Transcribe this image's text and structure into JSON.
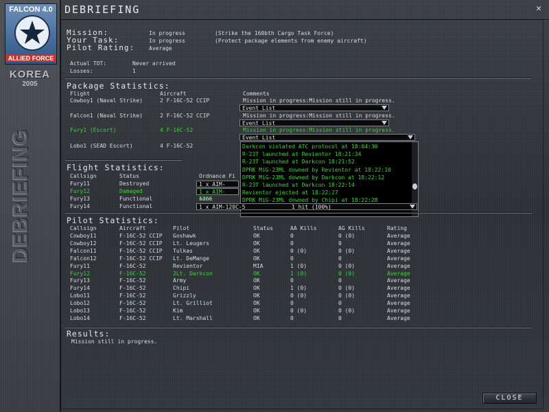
{
  "window": {
    "title": "DEBRIEFING",
    "close_icon": "close-icon"
  },
  "sidebar": {
    "logo_top": "FALCON 4.0",
    "logo_bottom": "ALLIED FORCE",
    "theater": "KOREA",
    "year": "2005",
    "vertical_title": "DEBRIEFING"
  },
  "summary": {
    "mission_label": "Mission:",
    "mission_status": "In progress",
    "mission_desc": "(Strike the 160bth Cargo Task Force)",
    "task_label": "Your Task:",
    "task_status": "In progress",
    "task_desc": "(Protect package elements from enemy aircraft)",
    "rating_label": "Pilot Rating:",
    "rating_value": "Average",
    "tot_label": "Actual TOT:",
    "tot_value": "Never arrived",
    "losses_label": "Losses:",
    "losses_value": "1"
  },
  "package": {
    "title": "Package Statistics:",
    "headers": [
      "Flight",
      "Aircraft",
      "Comments"
    ],
    "rows": [
      {
        "flight": "Cowboy1 (Naval Strike)",
        "aircraft": "2 F-16C-52 CCIP",
        "comment": "Mission in progress:Mission still in progress.",
        "dropdown": "Event List",
        "highlight": false
      },
      {
        "flight": "Falcon1 (Naval Strike)",
        "aircraft": "2 F-16C-52 CCIP",
        "comment": "Mission in progress:Mission still in progress.",
        "dropdown": "Event List",
        "highlight": false
      },
      {
        "flight": "Fury1 (Escort)",
        "aircraft": "4 F-16C-52",
        "comment": "Mission in progress:Mission still in progress.",
        "dropdown": "Event List",
        "highlight": true
      },
      {
        "flight": "Lobo1 (SEAD Escort)",
        "aircraft": "4 F-16C-52",
        "comment": "",
        "dropdown": "",
        "highlight": false
      }
    ],
    "event_list": [
      "Darkcon violated ATC protocol at 18:04:30",
      "R-23T launched at Revientor 18:21:34",
      "R-23T launched at Darkcon 18:21:52",
      "DPRK MiG-23ML downed by Revientor at 18:22:10",
      "DPRK MiG-23ML downed by Darkcon at 18:22:12",
      "R-23T launched at Darkcon 18:22:14",
      "Revientor ejected at 18:22:27",
      "DPRK MiG-23ML downed by Chipi at 18:22:28"
    ]
  },
  "flight_stats": {
    "title": "Flight Statistics:",
    "headers": [
      "Callsign",
      "Status",
      "Ordnance Fi"
    ],
    "rows": [
      {
        "callsign": "Fury11",
        "status": "Destroyed",
        "ordnance": "1 x AIM-120C",
        "hits": "",
        "highlight": false
      },
      {
        "callsign": "Fury12",
        "status": "Damaged",
        "ordnance": "1 x AIM-120C",
        "hits": "",
        "highlight": true
      },
      {
        "callsign": "Fury13",
        "status": "Functional",
        "ordnance": "none",
        "hits": "",
        "highlight": false
      },
      {
        "callsign": "Fury14",
        "status": "Functional",
        "ordnance": "1 x AIM-120C-5",
        "hits": "1 hit (100%)",
        "highlight": false
      }
    ]
  },
  "pilot_stats": {
    "title": "Pilot Statistics:",
    "headers": [
      "Callsign",
      "Aircraft",
      "Pilot",
      "Status",
      "AA Kills",
      "AG Kills",
      "Rating"
    ],
    "rows": [
      {
        "callsign": "Cowboy11",
        "aircraft": "F-16C-52 CCIP",
        "pilot": "Goshawk",
        "status": "OK",
        "aa": "0",
        "ag": "0 (0)",
        "rating": "Average",
        "hl": false
      },
      {
        "callsign": "Cowboy12",
        "aircraft": "F-16C-52 CCIP",
        "pilot": "Lt. Leugers",
        "status": "OK",
        "aa": "0",
        "ag": "0",
        "rating": "Average",
        "hl": false
      },
      {
        "callsign": "Falcon11",
        "aircraft": "F-16C-52 CCIP",
        "pilot": "Tulkas",
        "status": "OK",
        "aa": "0 (0)",
        "ag": "0 (0)",
        "rating": "Average",
        "hl": false
      },
      {
        "callsign": "Falcon12",
        "aircraft": "F-16C-52 CCIP",
        "pilot": "Lt. DeMange",
        "status": "OK",
        "aa": "0",
        "ag": "0",
        "rating": "Average",
        "hl": false
      },
      {
        "callsign": "Fury11",
        "aircraft": "F-16C-52",
        "pilot": "Revientor",
        "status": "MIA",
        "aa": "1 (0)",
        "ag": "0 (0)",
        "rating": "Average",
        "hl": false
      },
      {
        "callsign": "Fury12",
        "aircraft": "F-16C-52",
        "pilot": "2Lt. Darkcon",
        "status": "OK",
        "aa": "1 (0)",
        "ag": "0 (0)",
        "rating": "Average",
        "hl": true
      },
      {
        "callsign": "Fury13",
        "aircraft": "F-16C-52",
        "pilot": "Army",
        "status": "OK",
        "aa": "0",
        "ag": "0",
        "rating": "Average",
        "hl": false
      },
      {
        "callsign": "Fury14",
        "aircraft": "F-16C-52",
        "pilot": "Chipi",
        "status": "OK",
        "aa": "1 (0)",
        "ag": "0 (0)",
        "rating": "Average",
        "hl": false
      },
      {
        "callsign": "Lobo11",
        "aircraft": "F-16C-52",
        "pilot": "Grizzly",
        "status": "OK",
        "aa": "0 (0)",
        "ag": "0 (0)",
        "rating": "Average",
        "hl": false
      },
      {
        "callsign": "Lobo12",
        "aircraft": "F-16C-52",
        "pilot": "Lt. Grilliot",
        "status": "OK",
        "aa": "0",
        "ag": "0",
        "rating": "Average",
        "hl": false
      },
      {
        "callsign": "Lobo13",
        "aircraft": "F-16C-52",
        "pilot": "Kim",
        "status": "OK",
        "aa": "0 (0)",
        "ag": "0 (0)",
        "rating": "Average",
        "hl": false
      },
      {
        "callsign": "Lobo14",
        "aircraft": "F-16C-52",
        "pilot": "Lt. Marshall",
        "status": "OK",
        "aa": "0",
        "ag": "0",
        "rating": "Average",
        "hl": false
      }
    ]
  },
  "results": {
    "title": "Results:",
    "text": "Mission still in progress."
  },
  "buttons": {
    "close": "CLOSE"
  },
  "colors": {
    "highlight": "#3fd43a",
    "text": "#d8dde2",
    "panel": "#2e3237"
  }
}
